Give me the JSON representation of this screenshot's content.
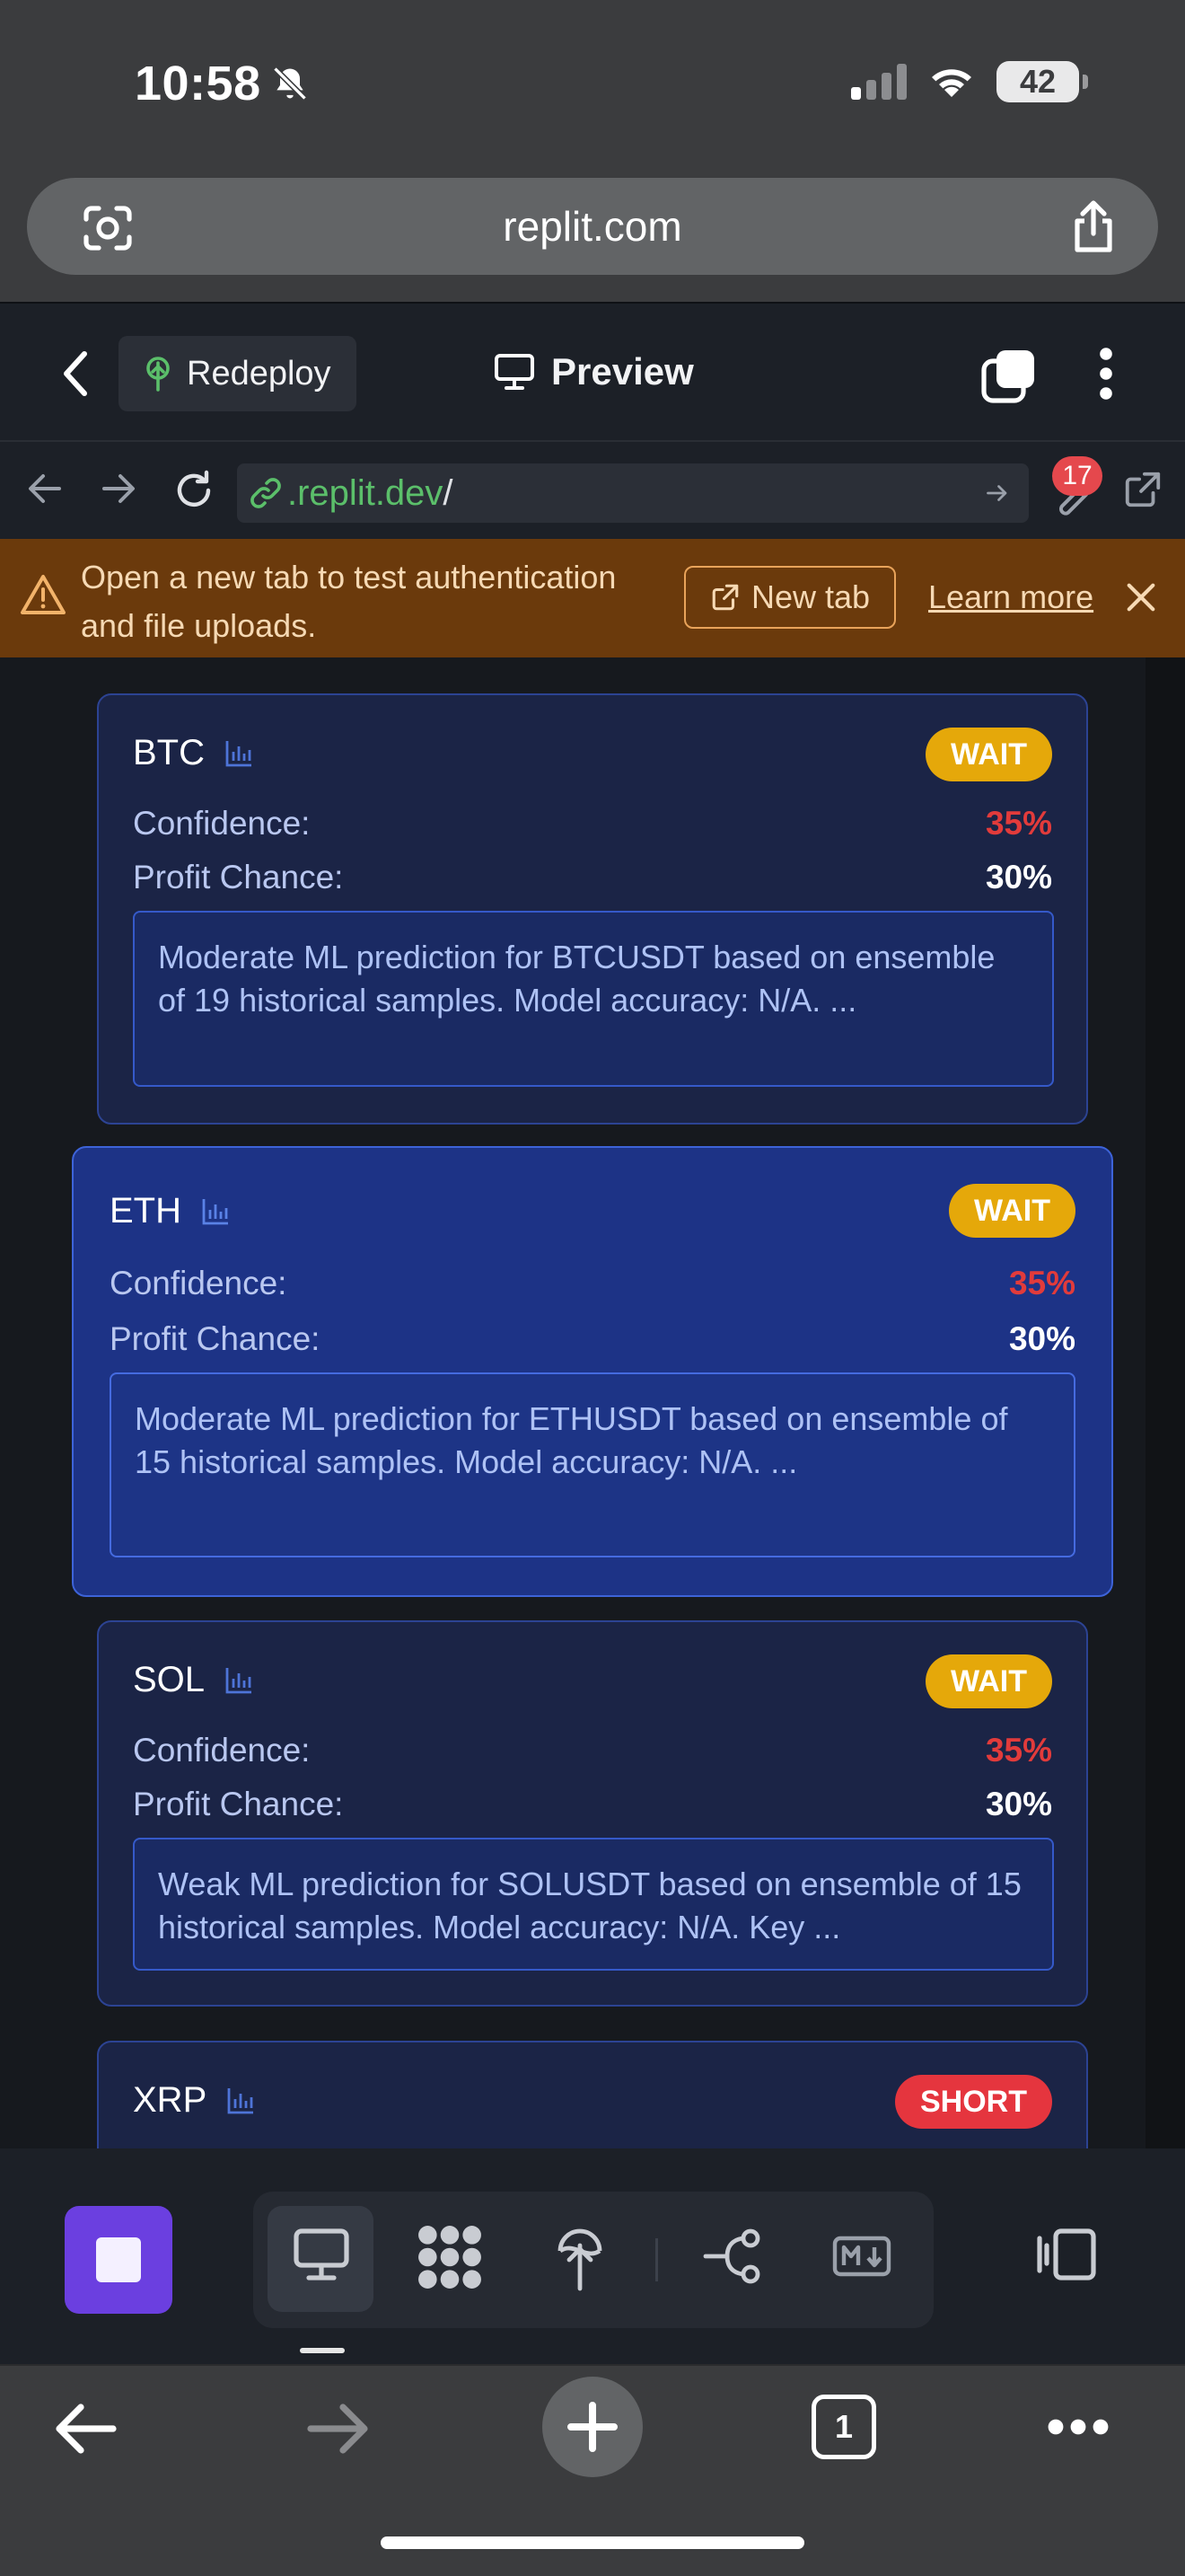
{
  "status_bar": {
    "time": "10:58",
    "battery": "42"
  },
  "safari": {
    "url": "replit.com",
    "tab_count": "1"
  },
  "replit_header": {
    "redeploy_label": "Redeploy",
    "preview_label": "Preview"
  },
  "browser_nav": {
    "url_host": ".replit.dev",
    "url_path": "/",
    "notification_count": "17"
  },
  "banner": {
    "message": "Open a new tab to test authentication and file uploads.",
    "new_tab_label": "New tab",
    "learn_more_label": "Learn more"
  },
  "labels": {
    "confidence": "Confidence:",
    "profit_chance": "Profit Chance:"
  },
  "cards": [
    {
      "symbol": "BTC",
      "signal": "WAIT",
      "confidence": "35%",
      "profit_chance": "30%",
      "description": "Moderate ML prediction for BTCUSDT based on ensemble of 19 historical samples. Model accuracy: N/A. ..."
    },
    {
      "symbol": "ETH",
      "signal": "WAIT",
      "confidence": "35%",
      "profit_chance": "30%",
      "description": "Moderate ML prediction for ETHUSDT based on ensemble of 15 historical samples. Model accuracy: N/A. ..."
    },
    {
      "symbol": "SOL",
      "signal": "WAIT",
      "confidence": "35%",
      "profit_chance": "30%",
      "description": "Weak ML prediction for SOLUSDT based on ensemble of 15 historical samples. Model accuracy: N/A. Key ..."
    },
    {
      "symbol": "XRP",
      "signal": "SHORT"
    }
  ],
  "colors": {
    "wait_badge": "#e5a80a",
    "short_badge": "#e5353e",
    "confidence_red": "#e23b3b",
    "run_button": "#6b3fe0",
    "warning_banner": "#6b3a0c"
  }
}
